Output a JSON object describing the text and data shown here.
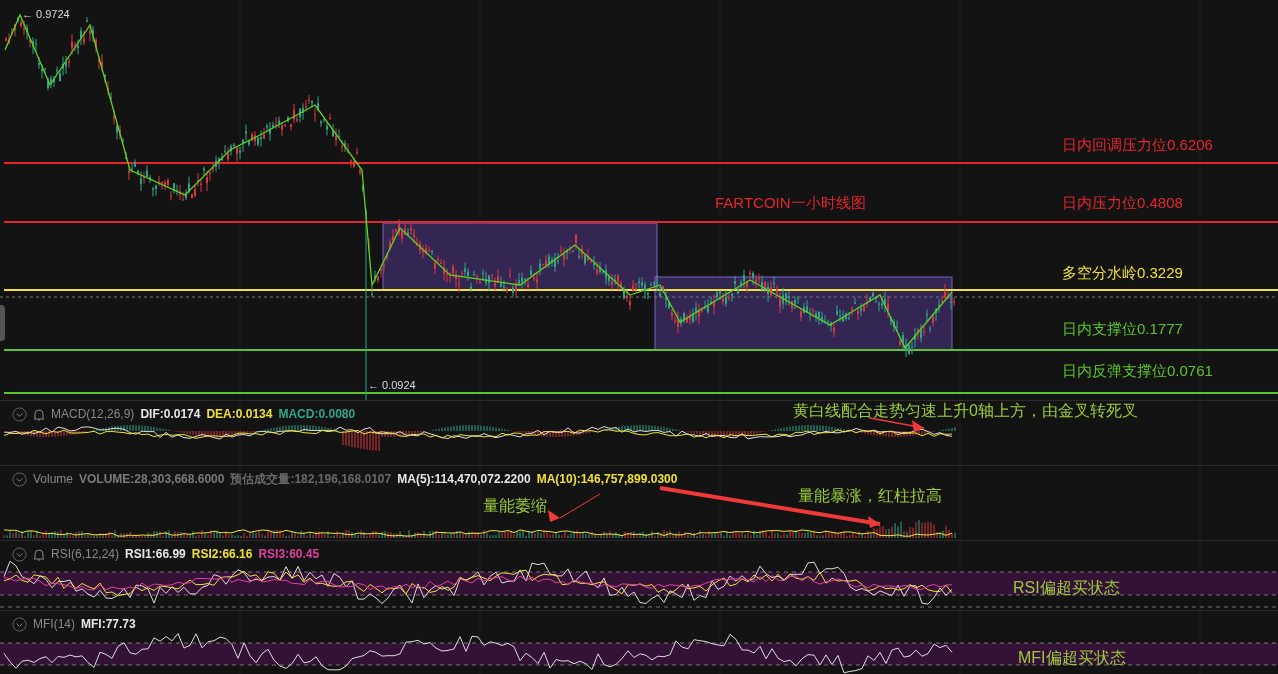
{
  "main_chart": {
    "title": "FARTCOIN一小时线图",
    "high_marker": "← 0.9724",
    "low_marker": "← 0.0924",
    "levels": [
      {
        "label": "日内回调压力位0.6206",
        "color": "#e5262e"
      },
      {
        "label": "日内压力位0.4808",
        "color": "#e5262e"
      },
      {
        "label": "多空分水岭0.3229",
        "color": "#f0e03a"
      },
      {
        "label": "日内支撑位0.1777",
        "color": "#5cc32c"
      },
      {
        "label": "日内反弹支撑位0.0761",
        "color": "#5cc32c"
      }
    ]
  },
  "panes": [
    {
      "kind": "macd",
      "name": "MACD(12,26,9)",
      "alert": true,
      "readings": [
        {
          "text": "DIF:0.0174",
          "color": "#e6e6e6"
        },
        {
          "text": "DEA:0.0134",
          "color": "#f0e03a"
        },
        {
          "text": "MACD:0.0080",
          "color": "#2fa58c"
        }
      ],
      "notes": [
        "黄白线配合走势匀速上升0轴上方，由金叉转死叉"
      ]
    },
    {
      "kind": "volume",
      "name": "Volume",
      "alert": false,
      "readings": [
        {
          "text": "VOLUME:28,303,668.6000",
          "color": "#7a7a7a"
        },
        {
          "text": "预估成交量:182,196,168.0107",
          "color": "#6a6a6a"
        },
        {
          "text": "MA(5):114,470,072.2200",
          "color": "#e6e6e6"
        },
        {
          "text": "MA(10):146,757,899.0300",
          "color": "#f0e03a"
        }
      ],
      "notes": [
        "量能萎缩",
        "量能暴涨，红柱拉高"
      ]
    },
    {
      "kind": "rsi",
      "name": "RSI(6,12,24)",
      "alert": true,
      "readings": [
        {
          "text": "RSI1:66.99",
          "color": "#e6e6e6"
        },
        {
          "text": "RSI2:66.16",
          "color": "#f0e03a"
        },
        {
          "text": "RSI3:60.45",
          "color": "#e040a0"
        }
      ],
      "notes": [
        "RSI偏超买状态"
      ]
    },
    {
      "kind": "mfi",
      "name": "MFI(14)",
      "alert": false,
      "readings": [
        {
          "text": "MFI:77.73",
          "color": "#e6e6e6"
        }
      ],
      "notes": [
        "MFI偏超买状态"
      ]
    }
  ]
}
